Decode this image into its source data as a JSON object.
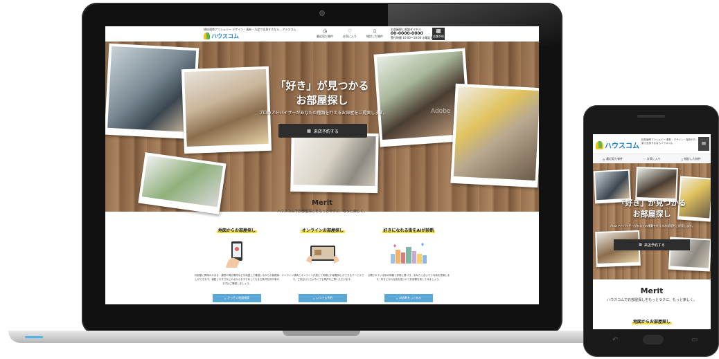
{
  "laptop_site": {
    "header": {
      "tagline": "桃枝通帯アリシェミー デザイン・真新・乃梁で含身するなら…アラスコム",
      "logo_text": "ハウスコム",
      "icons": [
        {
          "glyph": "◷",
          "label": "最近見た物件",
          "icon": "clock-icon"
        },
        {
          "glyph": "♡",
          "label": "お気に入り",
          "icon": "heart-icon"
        },
        {
          "glyph": "▯",
          "label": "検討した物件",
          "icon": "document-icon"
        }
      ],
      "phone_label": "お部屋探し相談ダイヤル",
      "phone_number": "00-0000-0000",
      "phone_hours": "受付時間 10:00～18:00 水曜定休",
      "menu_label": "店舗予約"
    },
    "hero": {
      "title_line1": "「好き」が見つかる",
      "title_line2": "お部屋探し",
      "subtitle": "プロのアドバイザーがあなたの種類を叶えるお部屋をご提案します。",
      "button_label": "来店予約する",
      "watermark": "Adobe"
    },
    "merit": {
      "title": "Merit",
      "subtitle": "ハウスコムでお部屋探しをもっとラクに、もっと楽しく。",
      "columns": [
        {
          "heading": "地図からお部屋探し",
          "text": "お部屋に興味のかある・通勤や周辺環境などを地図上で確認しながらお部屋探しができます。通勤しやすさなどの点からおすすめしてもまだ条件を探す事がまずはご確認しましょう。",
          "button": "さっそく地図検索"
        },
        {
          "heading": "オンラインお部屋探し",
          "text": "オンライン検索とオンライン内見にて気軽にお部屋探しができるサービスです。ご来店いただかなくても物件をご覧いただけます。",
          "button": "いつでも予約"
        },
        {
          "heading": "好きになれる街をAIが診断",
          "text": "公開されている街の情報と診断に基づき、あなたに合いそうな街を提案します。好きになれる街を見つけてお部屋を探してみましょう。",
          "button": "AI診断をしてみる"
        }
      ]
    }
  },
  "phone_site": {
    "header": {
      "logo_text": "ハウスコム",
      "tagline": "桃枝通帯アリシェミー 素材・デザイン・真新や乃梁で含身するならハウスコム",
      "menu_glyph": "≡"
    },
    "bar": [
      {
        "glyph": "◷",
        "label": "最近見た物件"
      },
      {
        "glyph": "♡",
        "label": "お気に入り"
      },
      {
        "glyph": "▯",
        "label": "検討した物件"
      }
    ],
    "hero": {
      "title_line1": "「好き」が見つかる",
      "title_line2": "お部屋探し",
      "subtitle": "プロのアドバイザーがあなたの種類を叶えるお部屋をご提案します。",
      "button_label": "来店予約する"
    },
    "merit": {
      "title": "Merit",
      "subtitle": "ハウスコムでお部屋探しをもっとラクに、もっと楽しく。",
      "first_heading": "地図からお部屋探し"
    }
  },
  "colors": {
    "brand_blue": "#1b7fc4",
    "accent_yellow": "#f5e13a",
    "button_dark": "#2d2d2d",
    "button_blue": "#5ba7d6"
  }
}
